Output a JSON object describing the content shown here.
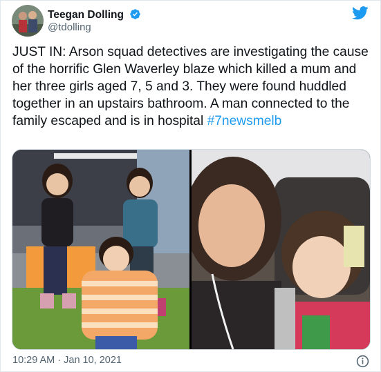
{
  "author": {
    "name": "Teegan Dolling",
    "handle": "@tdolling",
    "verified_icon": "verified-badge-icon",
    "avatar_icon": "profile-photo"
  },
  "platform_icon": "twitter-bird-icon",
  "tweet": {
    "text": "JUST IN: Arson squad detectives are investigating the cause of the horrific Glen Waverley blaze which killed a mum and her three girls aged 7, 5 and 3. They were found huddled together in an upstairs bathroom. A man connected to the family escaped and is in hospital",
    "hashtag": "#7newsmelb"
  },
  "timestamp": "10:29 AM · Jan 10, 2021",
  "info_icon": "info-icon",
  "colors": {
    "accent": "#1d9bf0",
    "text": "#0f1419",
    "secondary": "#536471"
  }
}
